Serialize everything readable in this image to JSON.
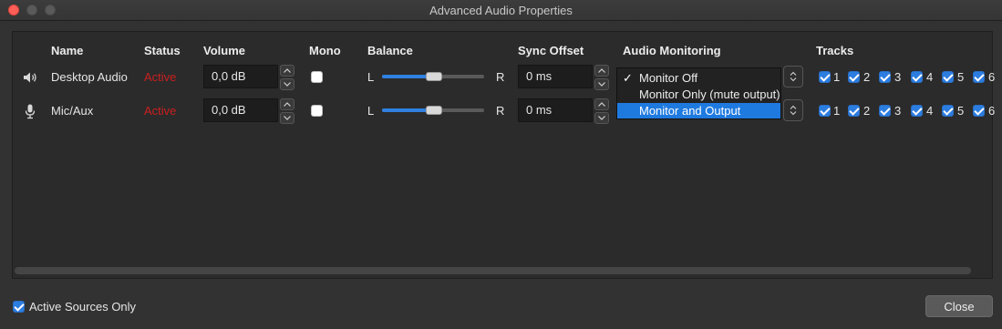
{
  "window": {
    "title": "Advanced Audio Properties"
  },
  "headers": {
    "name": "Name",
    "status": "Status",
    "volume": "Volume",
    "mono": "Mono",
    "balance": "Balance",
    "sync_offset": "Sync Offset",
    "audio_monitoring": "Audio Monitoring",
    "tracks": "Tracks"
  },
  "rows": [
    {
      "name": "Desktop Audio",
      "icon": "speaker-icon",
      "status": "Active",
      "volume": "0,0 dB",
      "mono": false,
      "balance_left": "L",
      "balance_right": "R",
      "balance_value": 0.5,
      "sync_offset": "0 ms",
      "monitoring": "Monitor Off",
      "tracks": [
        "1",
        "2",
        "3",
        "4",
        "5",
        "6"
      ]
    },
    {
      "name": "Mic/Aux",
      "icon": "microphone-icon",
      "status": "Active",
      "volume": "0,0 dB",
      "mono": false,
      "balance_left": "L",
      "balance_right": "R",
      "balance_value": 0.5,
      "sync_offset": "0 ms",
      "monitoring": "Monitor and Output",
      "tracks": [
        "1",
        "2",
        "3",
        "4",
        "5",
        "6"
      ]
    }
  ],
  "monitoring_dropdown": {
    "options": [
      "Monitor Off",
      "Monitor Only (mute output)",
      "Monitor and Output"
    ],
    "checked_option": "Monitor Off",
    "highlighted_option": "Monitor and Output",
    "check_mark": "✓"
  },
  "footer": {
    "active_sources_only_label": "Active Sources Only",
    "active_sources_only_checked": true,
    "close_label": "Close"
  },
  "colors": {
    "status_active": "#cc1f1f",
    "accent": "#1f7ae0"
  }
}
